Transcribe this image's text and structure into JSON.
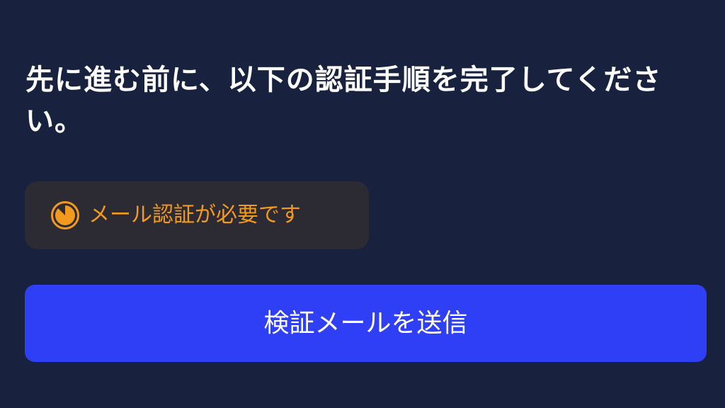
{
  "prompt": {
    "message": "先に進む前に、以下の認証手順を完了してください。"
  },
  "status_badge": {
    "icon": "clock-icon",
    "text": "メール認証が必要です",
    "color": "#f39a1e",
    "background": "#2c2a33"
  },
  "actions": {
    "send_verification_label": "検証メールを送信",
    "button_color": "#2f3ff5"
  },
  "theme": {
    "background": "#18223f",
    "text_color": "#ffffff"
  }
}
